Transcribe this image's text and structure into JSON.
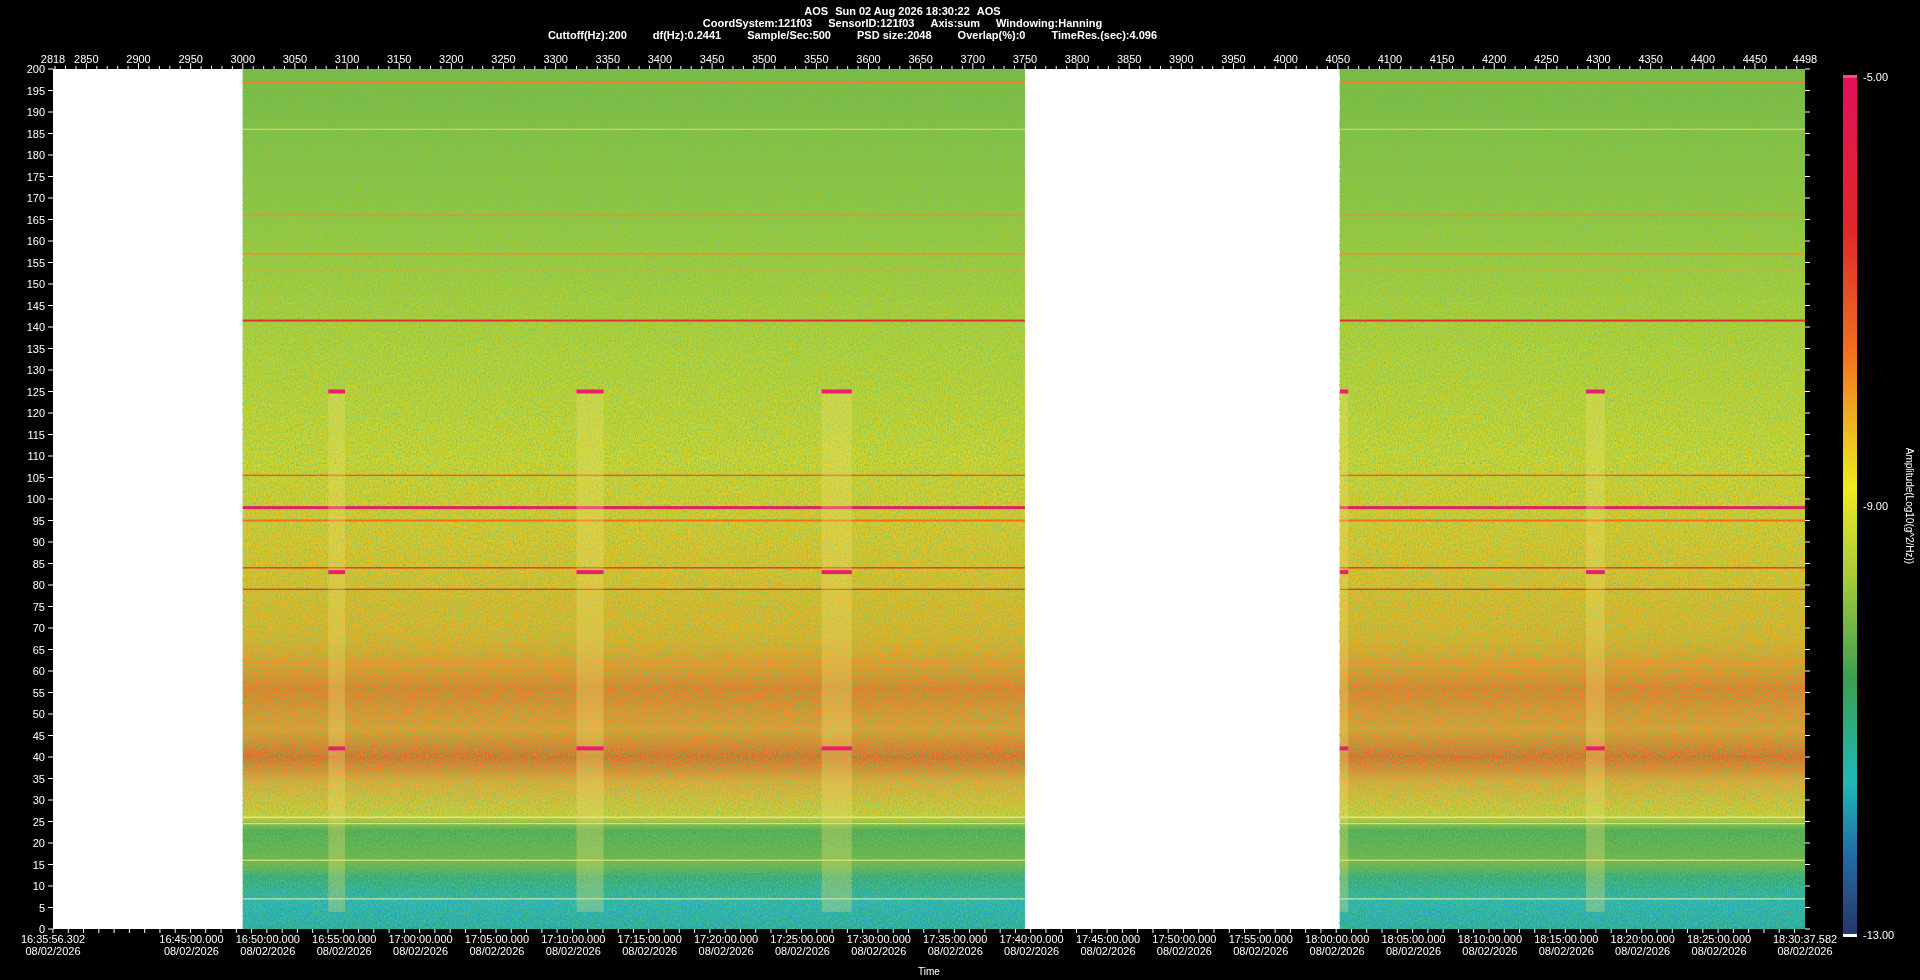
{
  "header": {
    "title_items": [
      "AOS",
      "Sun 02 Aug 2026 18:30:22",
      "AOS"
    ],
    "line_2": [
      "CoordSystem:121f03",
      "SensorID:121f03",
      "Axis:sum",
      "Windowing:Hanning"
    ],
    "line_3": [
      "Cuttoff(Hz):200",
      "df(Hz):0.2441",
      "Sample/Sec:500",
      "PSD size:2048",
      "Overlap(%):0",
      "TimeRes.(sec):4.096"
    ]
  },
  "top_axis": {
    "labels": [
      "2818",
      "2850",
      "2900",
      "2950",
      "3000",
      "3050",
      "3100",
      "3150",
      "3200",
      "3250",
      "3300",
      "3350",
      "3400",
      "3450",
      "3500",
      "3550",
      "3600",
      "3650",
      "3700",
      "3750",
      "3800",
      "3850",
      "3900",
      "3950",
      "4000",
      "4050",
      "4100",
      "4150",
      "4200",
      "4250",
      "4300",
      "4350",
      "4400",
      "4450",
      "4498"
    ]
  },
  "frequency_axis": {
    "labels": [
      "200",
      "195",
      "190",
      "185",
      "180",
      "175",
      "170",
      "165",
      "160",
      "155",
      "150",
      "145",
      "140",
      "135",
      "130",
      "125",
      "120",
      "115",
      "110",
      "105",
      "100",
      "95",
      "90",
      "85",
      "80",
      "75",
      "70",
      "65",
      "60",
      "55",
      "50",
      "45",
      "40",
      "35",
      "30",
      "25",
      "20",
      "15",
      "10",
      "5",
      "0"
    ]
  },
  "time_axis": {
    "title": "Time",
    "labels": [
      {
        "time": "16:35:56.302",
        "date": "08/02/2026"
      },
      {
        "time": "16:45:00.000",
        "date": "08/02/2026"
      },
      {
        "time": "16:50:00.000",
        "date": "08/02/2026"
      },
      {
        "time": "16:55:00.000",
        "date": "08/02/2026"
      },
      {
        "time": "17:00:00.000",
        "date": "08/02/2026"
      },
      {
        "time": "17:05:00.000",
        "date": "08/02/2026"
      },
      {
        "time": "17:10:00.000",
        "date": "08/02/2026"
      },
      {
        "time": "17:15:00.000",
        "date": "08/02/2026"
      },
      {
        "time": "17:20:00.000",
        "date": "08/02/2026"
      },
      {
        "time": "17:25:00.000",
        "date": "08/02/2026"
      },
      {
        "time": "17:30:00.000",
        "date": "08/02/2026"
      },
      {
        "time": "17:35:00.000",
        "date": "08/02/2026"
      },
      {
        "time": "17:40:00.000",
        "date": "08/02/2026"
      },
      {
        "time": "17:45:00.000",
        "date": "08/02/2026"
      },
      {
        "time": "17:50:00.000",
        "date": "08/02/2026"
      },
      {
        "time": "17:55:00.000",
        "date": "08/02/2026"
      },
      {
        "time": "18:00:00.000",
        "date": "08/02/2026"
      },
      {
        "time": "18:05:00.000",
        "date": "08/02/2026"
      },
      {
        "time": "18:10:00.000",
        "date": "08/02/2026"
      },
      {
        "time": "18:15:00.000",
        "date": "08/02/2026"
      },
      {
        "time": "18:20:00.000",
        "date": "08/02/2026"
      },
      {
        "time": "18:25:00.000",
        "date": "08/02/2026"
      },
      {
        "time": "18:30:37.582",
        "date": "08/02/2026"
      }
    ]
  },
  "colorbar": {
    "max_label": "-5.00",
    "mid_label": "-9.00",
    "min_label": "-13.00",
    "title": "Amplitude(Log10(g^2/Hz))"
  }
}
